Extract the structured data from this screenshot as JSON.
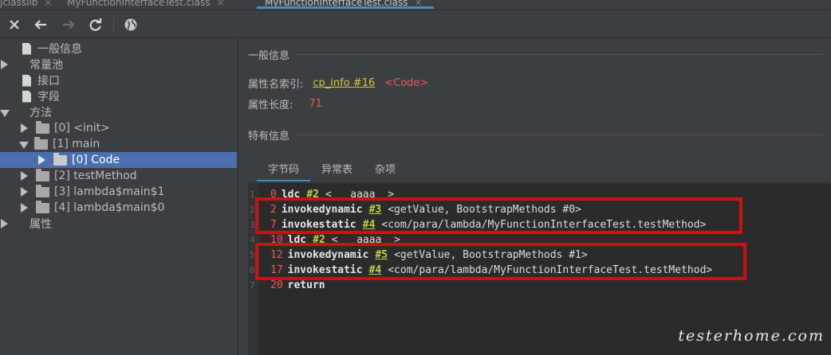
{
  "tabs": [
    {
      "label": "jclasslib",
      "active": false
    },
    {
      "label": "MyFunctionInterfaceTest.class",
      "active": false
    },
    {
      "label": "MyFunctionInterfaceTest.class",
      "active": true
    }
  ],
  "toolbar": {
    "close_icon": "close-icon",
    "back_icon": "arrow-left-icon",
    "forward_icon": "arrow-right-icon",
    "refresh_icon": "refresh-icon",
    "web_icon": "globe-icon"
  },
  "tree": {
    "items": [
      {
        "label": "一般信息",
        "level": 0,
        "expander": "none",
        "icon": "file-icon"
      },
      {
        "label": "常量池",
        "level": 0,
        "expander": "collapsed",
        "icon": "none"
      },
      {
        "label": "接口",
        "level": 0,
        "expander": "none",
        "icon": "file-icon"
      },
      {
        "label": "字段",
        "level": 0,
        "expander": "none",
        "icon": "file-icon"
      },
      {
        "label": "方法",
        "level": 0,
        "expander": "expanded",
        "icon": "none"
      },
      {
        "label": "[0] <init>",
        "level": 1,
        "expander": "collapsed",
        "icon": "folder-icon"
      },
      {
        "label": "[1] main",
        "level": 1,
        "expander": "expanded",
        "icon": "folder-icon"
      },
      {
        "label": "[0] Code",
        "level": 2,
        "expander": "collapsed",
        "icon": "folder-icon",
        "selected": true
      },
      {
        "label": "[2] testMethod",
        "level": 1,
        "expander": "collapsed",
        "icon": "folder-icon"
      },
      {
        "label": "[3] lambda$main$1",
        "level": 1,
        "expander": "collapsed",
        "icon": "folder-icon"
      },
      {
        "label": "[4] lambda$main$0",
        "level": 1,
        "expander": "collapsed",
        "icon": "folder-icon"
      },
      {
        "label": "属性",
        "level": 0,
        "expander": "collapsed",
        "icon": "none"
      }
    ]
  },
  "detail": {
    "general_title": "一般信息",
    "attr_name_label": "属性名索引:",
    "attr_name_link": "cp_info #16",
    "attr_name_value": "<Code>",
    "attr_length_label": "属性长度:",
    "attr_length_value": "71",
    "specific_title": "特有信息",
    "subtabs": [
      "字节码",
      "异常表",
      "杂项"
    ],
    "active_subtab": 0
  },
  "code": {
    "lines": [
      {
        "ln": "1",
        "offset": "0",
        "op": "ldc",
        "cp": "#2",
        "arg": "<   aaaa  >"
      },
      {
        "ln": "2",
        "offset": "2",
        "op": "invokedynamic",
        "cp": "#3",
        "arg": "<getValue, BootstrapMethods #0>"
      },
      {
        "ln": "3",
        "offset": "7",
        "op": "invokestatic",
        "cp": "#4",
        "arg": "<com/para/lambda/MyFunctionInterfaceTest.testMethod>"
      },
      {
        "ln": "4",
        "offset": "10",
        "op": "ldc",
        "cp": "#2",
        "arg": "<   aaaa  >"
      },
      {
        "ln": "5",
        "offset": "12",
        "op": "invokedynamic",
        "cp": "#5",
        "arg": "<getValue, BootstrapMethods #1>"
      },
      {
        "ln": "6",
        "offset": "17",
        "op": "invokestatic",
        "cp": "#4",
        "arg": "<com/para/lambda/MyFunctionInterfaceTest.testMethod>"
      },
      {
        "ln": "7",
        "offset": "20",
        "op": "return",
        "cp": "",
        "arg": ""
      }
    ]
  },
  "watermark": "testerhome.com",
  "colors": {
    "accent": "#4a88c7",
    "selection": "#4b6eaf",
    "highlight_box": "#d01010",
    "offset": "#e85a5a",
    "cp_ref": "#c6d043"
  }
}
